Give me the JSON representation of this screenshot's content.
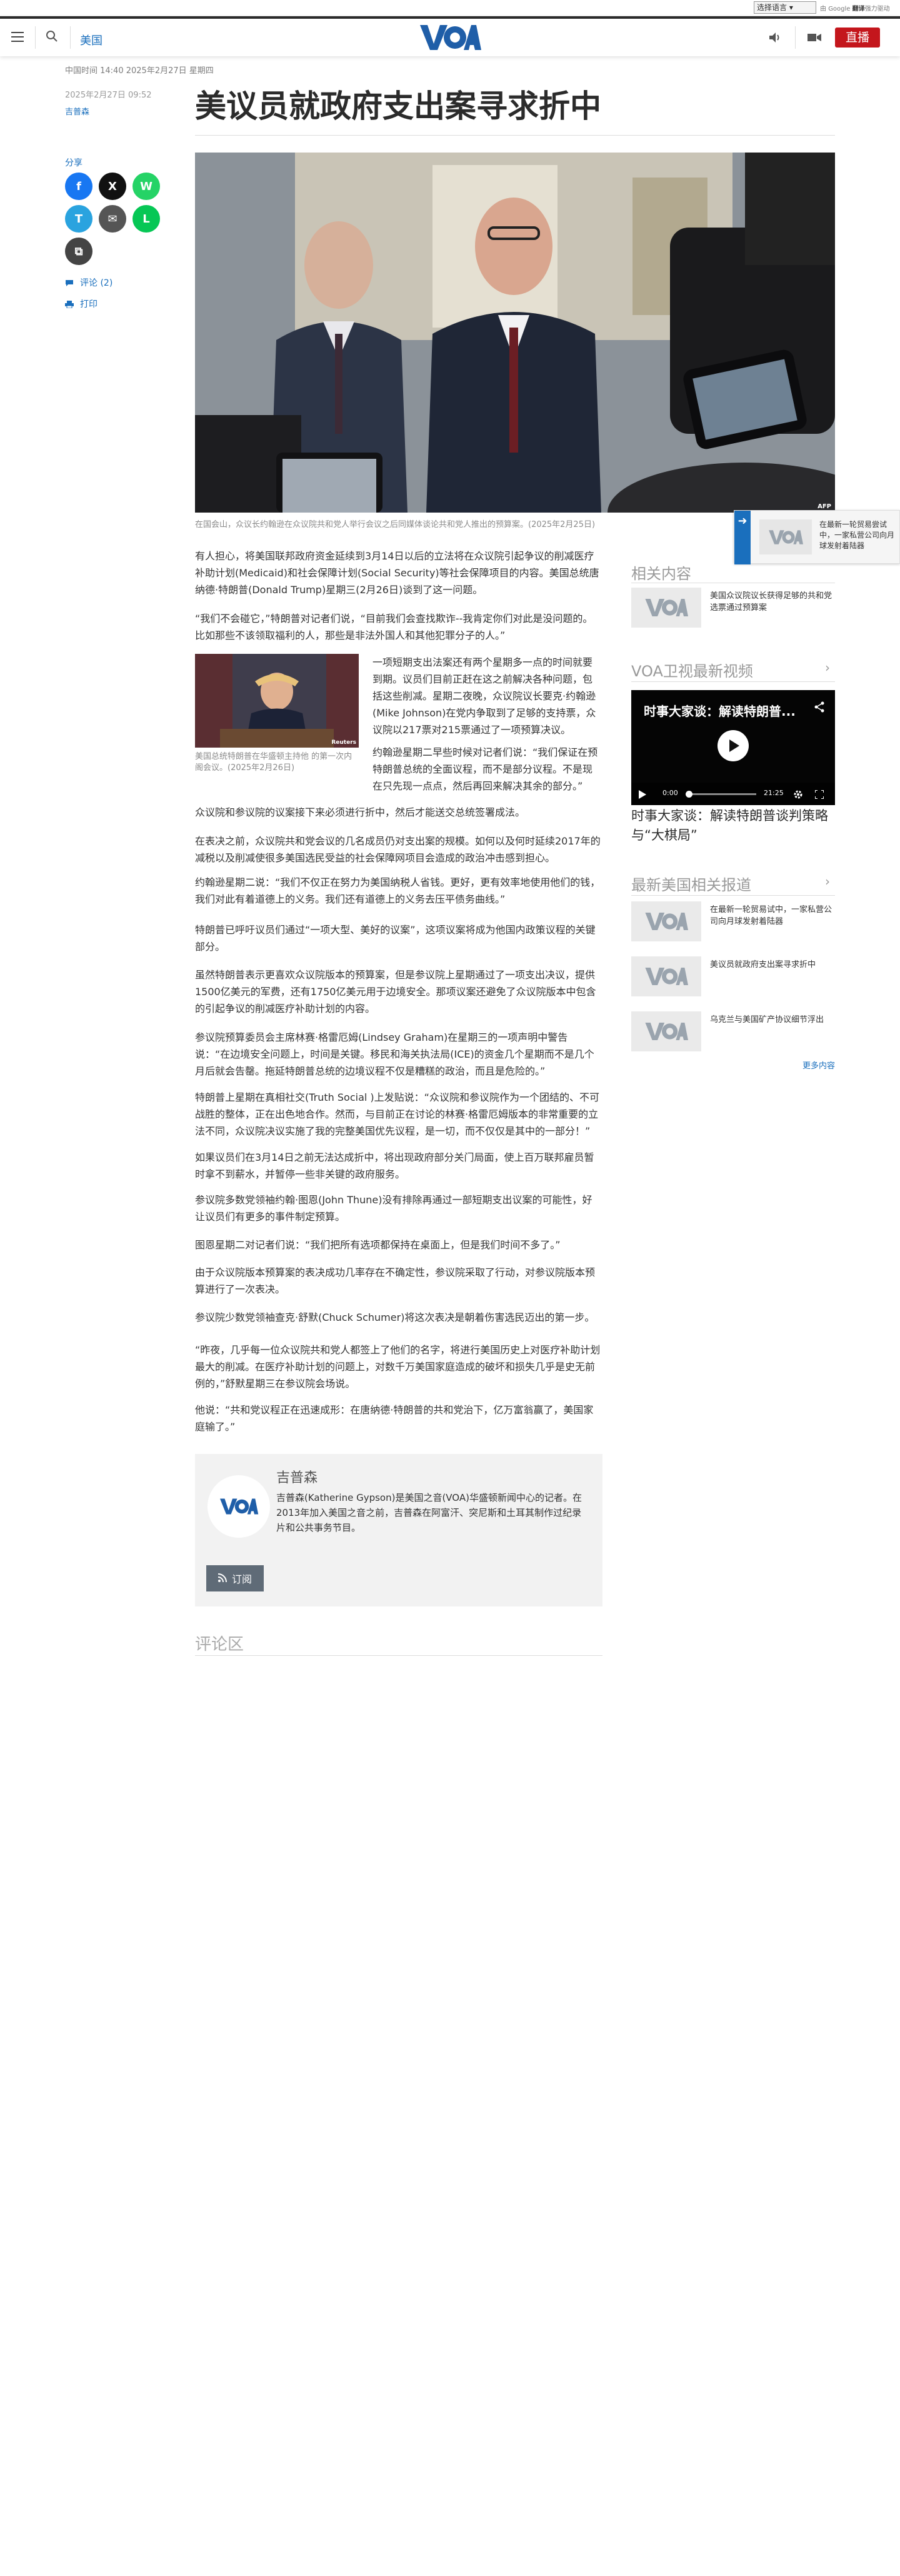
{
  "translate": {
    "select_label": "选择语言",
    "powered_prefix": "由",
    "google": "Google",
    "translate_word": "翻译",
    "powered_suffix": "强力驱动"
  },
  "header": {
    "section": "美国",
    "logo": "VOA",
    "live": "直播"
  },
  "article": {
    "page_time": "中国时间 14:40 2025年2月27日 星期四",
    "date": "2025年2月27日 09:52",
    "author": "吉普森",
    "title": "美议员就政府支出案寻求折中",
    "hero_caption": "在国会山，众议长约翰逊在众议院共和党人举行会议之后同媒体谈论共和党人推出的预算案。(2025年2月25日)",
    "hero_credit": "AFP",
    "inline_caption": "美国总统特朗普在华盛顿主持他 的第一次内阁会议。(2025年2月26日)",
    "inline_credit": "Reuters",
    "lead": "有人担心，将美国联邦政府资金延续到3月14日以后的立法将在众议院引起争议的削减医疗补助计划(Medicaid)和社会保障计划(Social Security)等社会保障项目的内容。美国总统唐纳德·特朗普(Donald Trump)星期三(2月26日)谈到了这一问题。",
    "p1": "“我们不会碰它，”特朗普对记者们说，“目前我们会查找欺诈--我肯定你们对此是没问题的。比如那些不该领取福利的人，那些是非法外国人和其他犯罪分子的人。”",
    "p2": "一项短期支出法案还有两个星期多一点的时间就要到期。议员们目前正赶在这之前解决各种问题，包括这些削减。星期二夜晚，众议院议长要克·约翰逊(Mike Johnson)在党内争取到了足够的支持票，众议院以217票对215票通过了一项预算决议。",
    "p3": "约翰逊星期二早些时候对记者们说：“我们保证在预特朗普总统的全面议程，而不是部分议程。不是现在只先现一点点，然后再回来解决其余的部分。”",
    "p4": "众议院和参议院的议案接下来必须进行折中，然后才能送交总统签署成法。",
    "p5": "在表决之前，众议院共和党会议的几名成员仍对支出案的规模。如何以及何时延续2017年的减税以及削减使很多美国选民受益的社会保障网项目会造成的政治冲击感到担心。",
    "p6": "约翰逊星期二说：“我们不仅正在努力为美国纳税人省钱。更好，更有效率地使用他们的钱，我们对此有着道德上的义务。我们还有道德上的义务去压平债务曲线。”",
    "p7": "特朗普已呼吁议员们通过“一项大型、美好的议案”，这项议案将成为他国内政策议程的关键部分。",
    "p8": "虽然特朗普表示更喜欢众议院版本的预算案，但是参议院上星期通过了一项支出决议，提供1500亿美元的军费，还有1750亿美元用于边境安全。那项议案还避免了众议院版本中包含的引起争议的削减医疗补助计划的内容。",
    "p9": "参议院预算委员会主席林赛·格雷厄姆(Lindsey Graham)在星期三的一项声明中警告说：“在边境安全问题上，时间是关键。移民和海关执法局(ICE)的资金几个星期而不是几个月后就会告罄。拖延特朗普总统的边境议程不仅是糟糕的政治，而且是危险的。”",
    "p10": "特朗普上星期在真相社交(Truth Social )上发贴说：“众议院和参议院作为一个团结的、不可战胜的整体，正在出色地合作。然而，与目前正在讨论的林赛·格雷厄姆版本的非常重要的立法不同，众议院决议实施了我的完整美国优先议程，是一切，而不仅仅是其中的一部分！”",
    "p11": "如果议员们在3月14日之前无法达成折中，将出现政府部分关门局面，使上百万联邦雇员暂时拿不到薪水，并暂停一些非关键的政府服务。",
    "p12": "参议院多数党领袖约翰·图恩(John Thune)没有排除再通过一部短期支出议案的可能性，好让议员们有更多的事件制定预算。",
    "p13": "图恩星期二对记者们说：“我们把所有选项都保持在桌面上，但是我们时间不多了。”",
    "p14": "由于众议院版本预算案的表决成功几率存在不确定性，参议院采取了行动，对参议院版本预算进行了一次表决。",
    "p15": "参议院少数党领袖查克·舒默(Chuck Schumer)将这次表决是朝着伤害选民迈出的第一步。",
    "p16": "“昨夜，几乎每一位众议院共和党人都签上了他们的名字，将进行美国历史上对医疗补助计划最大的削减。在医疗补助计划的问题上，对数千万美国家庭造成的破坏和损失几乎是史无前例的，”舒默星期三在参议院会场说。",
    "p17": "他说：“共和党议程正在迅速成形：在唐纳德·特朗普的共和党治下，亿万富翁赢了，美国家庭输了。”"
  },
  "sidebar": {
    "share_label": "分享",
    "share_buttons": [
      "f",
      "X",
      "W",
      "T",
      "✉",
      "L",
      "⧉"
    ],
    "comments": "评论 (2)",
    "print": "打印"
  },
  "author_box": {
    "name": "吉普森",
    "bio": "吉普森(Katherine Gypson)是美国之音(VOA)华盛顿新闻中心的记者。在2013年加入美国之音之前，吉普森在阿富汗、突尼斯和土耳其制作过纪录片和公共事务节目。",
    "subscribe": "订阅"
  },
  "comments_title": "评论区",
  "right": {
    "related_heading": "相关内容",
    "related_items": [
      {
        "text": "美国众议院议长获得足够的共和党选票通过预算案"
      }
    ],
    "video_heading": "VOA卫视最新视频",
    "video_overlay_title": "时事大家谈：解读特朗普...",
    "video_time_current": "0:00",
    "video_time_total": "21:25",
    "video_title": "时事大家谈：解读特朗普谈判策略与“大棋局”",
    "latest_heading": "最新美国相关报道",
    "latest_items": [
      {
        "text": "在最新一轮贸易试中，一家私营公司向月球发射着陆器"
      },
      {
        "text": "美议员就政府支出案寻求折中"
      },
      {
        "text": "乌克兰与美国矿产协议细节浮出"
      }
    ],
    "more": "更多内容"
  },
  "float_card": {
    "text": "在最新一轮贸易尝试中，一家私营公司向月球发射着陆器"
  }
}
